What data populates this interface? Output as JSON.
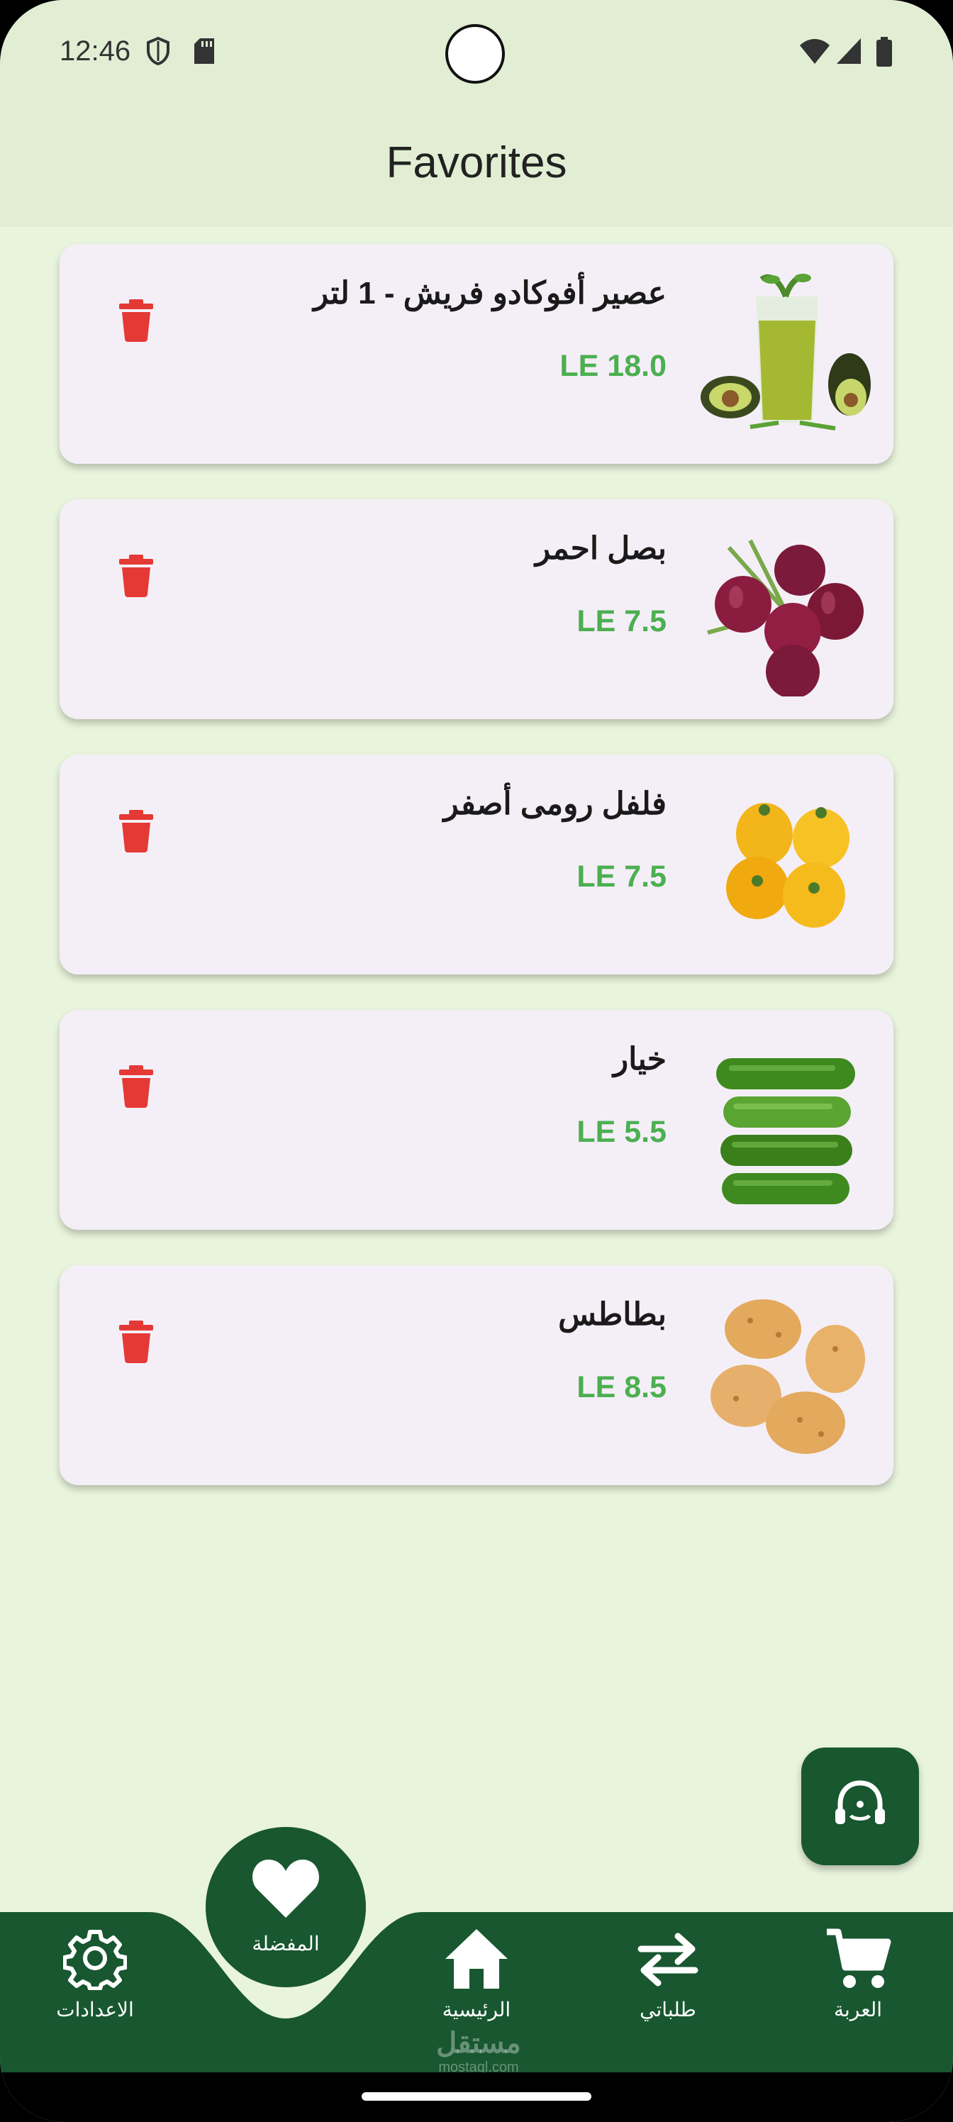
{
  "status_bar": {
    "time": "12:46"
  },
  "app_bar": {
    "title": "Favorites"
  },
  "favorites": [
    {
      "name": "عصير أفوكادو فريش - 1 لتر",
      "price": "LE 18.0",
      "image": "avocado-juice-image"
    },
    {
      "name": "بصل احمر",
      "price": "LE 7.5",
      "image": "red-onion-image"
    },
    {
      "name": "فلفل رومى أصفر",
      "price": "LE 7.5",
      "image": "yellow-pepper-image"
    },
    {
      "name": "خيار",
      "price": "LE 5.5",
      "image": "cucumber-image"
    },
    {
      "name": "بطاطس",
      "price": "LE 8.5",
      "image": "potato-image"
    }
  ],
  "bottom_nav": {
    "settings": "الاعدادات",
    "favorites": "المفضلة",
    "home": "الرئيسية",
    "orders": "طلباتي",
    "cart": "العربة"
  },
  "watermark": {
    "arabic": "مستقل",
    "latin": "mostaql.com"
  },
  "colors": {
    "primary": "#185730",
    "price": "#4caf50",
    "delete": "#e53935",
    "card": "#f4eff7",
    "background": "#e9f4dc"
  }
}
